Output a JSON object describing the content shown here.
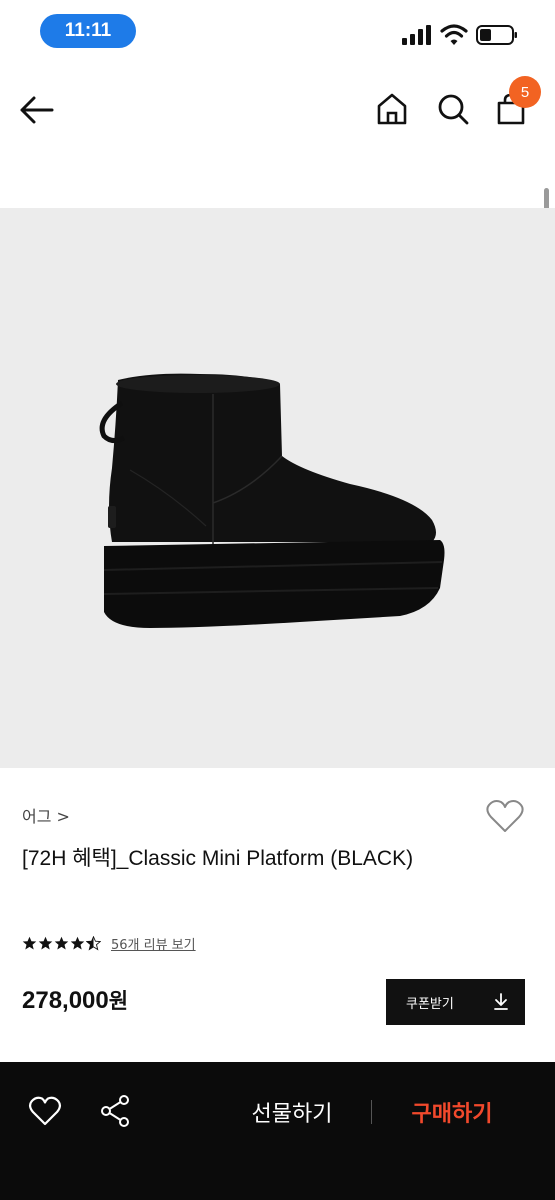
{
  "status_bar": {
    "time": "11:11",
    "time_color": "#1e7be8"
  },
  "header": {
    "icons": [
      "back-icon",
      "home-icon",
      "search-icon",
      "cart-icon"
    ],
    "cart_count": "5",
    "badge_color": "#f26322"
  },
  "product": {
    "image_alt_icon": "boot-image",
    "brand": "어그 >",
    "title": "[72H 혜택]_Classic Mini Platform (BLACK)",
    "rating": 4.5,
    "review_link": "56개 리뷰 보기",
    "price_number": "278,000",
    "price_unit": "원",
    "coupon_label": "쿠폰받기"
  },
  "bottom_bar": {
    "gift_label": "선물하기",
    "buy_label": "구매하기",
    "buy_color": "#f2492c"
  }
}
